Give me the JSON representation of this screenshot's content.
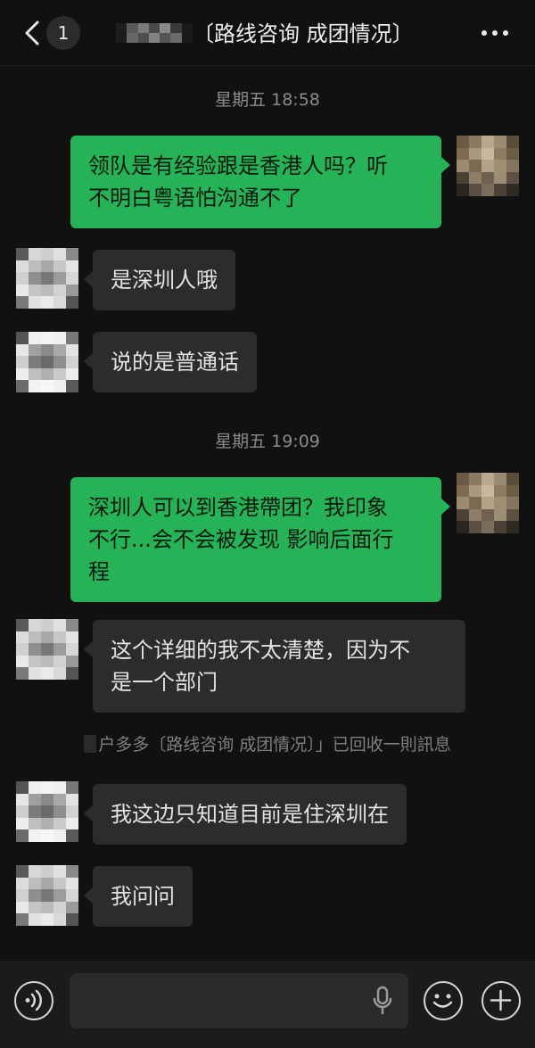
{
  "header": {
    "unread_count": "1",
    "title": "〔路线咨询 成团情况〕"
  },
  "timestamps": [
    "星期五 18:58",
    "星期五 19:09"
  ],
  "messages": [
    {
      "side": "out",
      "text": "领队是有经验跟是香港人吗？听\n不明白粤语怕沟通不了"
    },
    {
      "side": "in",
      "text": "是深圳人哦"
    },
    {
      "side": "in",
      "text": "说的是普通话"
    },
    {
      "side": "out",
      "text": "深圳人可以到香港帶团？我印象\n不行...会不会被发现 影响后面行\n程"
    },
    {
      "side": "in",
      "text": "这个详细的我不太清楚，因为不\n是一个部门"
    },
    {
      "side": "in",
      "text": "我这边只知道目前是住深圳在"
    },
    {
      "side": "in",
      "text": "我问问"
    }
  ],
  "recall_notice": "户多多〔路线咨询 成团情况〕」已回收一則訊息",
  "input": {
    "value": "",
    "placeholder": ""
  },
  "icons": {
    "back": "chevron-left-icon",
    "more": "more-dots-icon",
    "voice": "voice-mode-icon",
    "mic": "microphone-icon",
    "emoji": "emoji-icon",
    "plus": "plus-icon"
  },
  "colors": {
    "background": "#111111",
    "outgoing_bubble": "#26b256",
    "incoming_bubble": "#2c2c2c",
    "input_bar": "#1b1b1b"
  }
}
